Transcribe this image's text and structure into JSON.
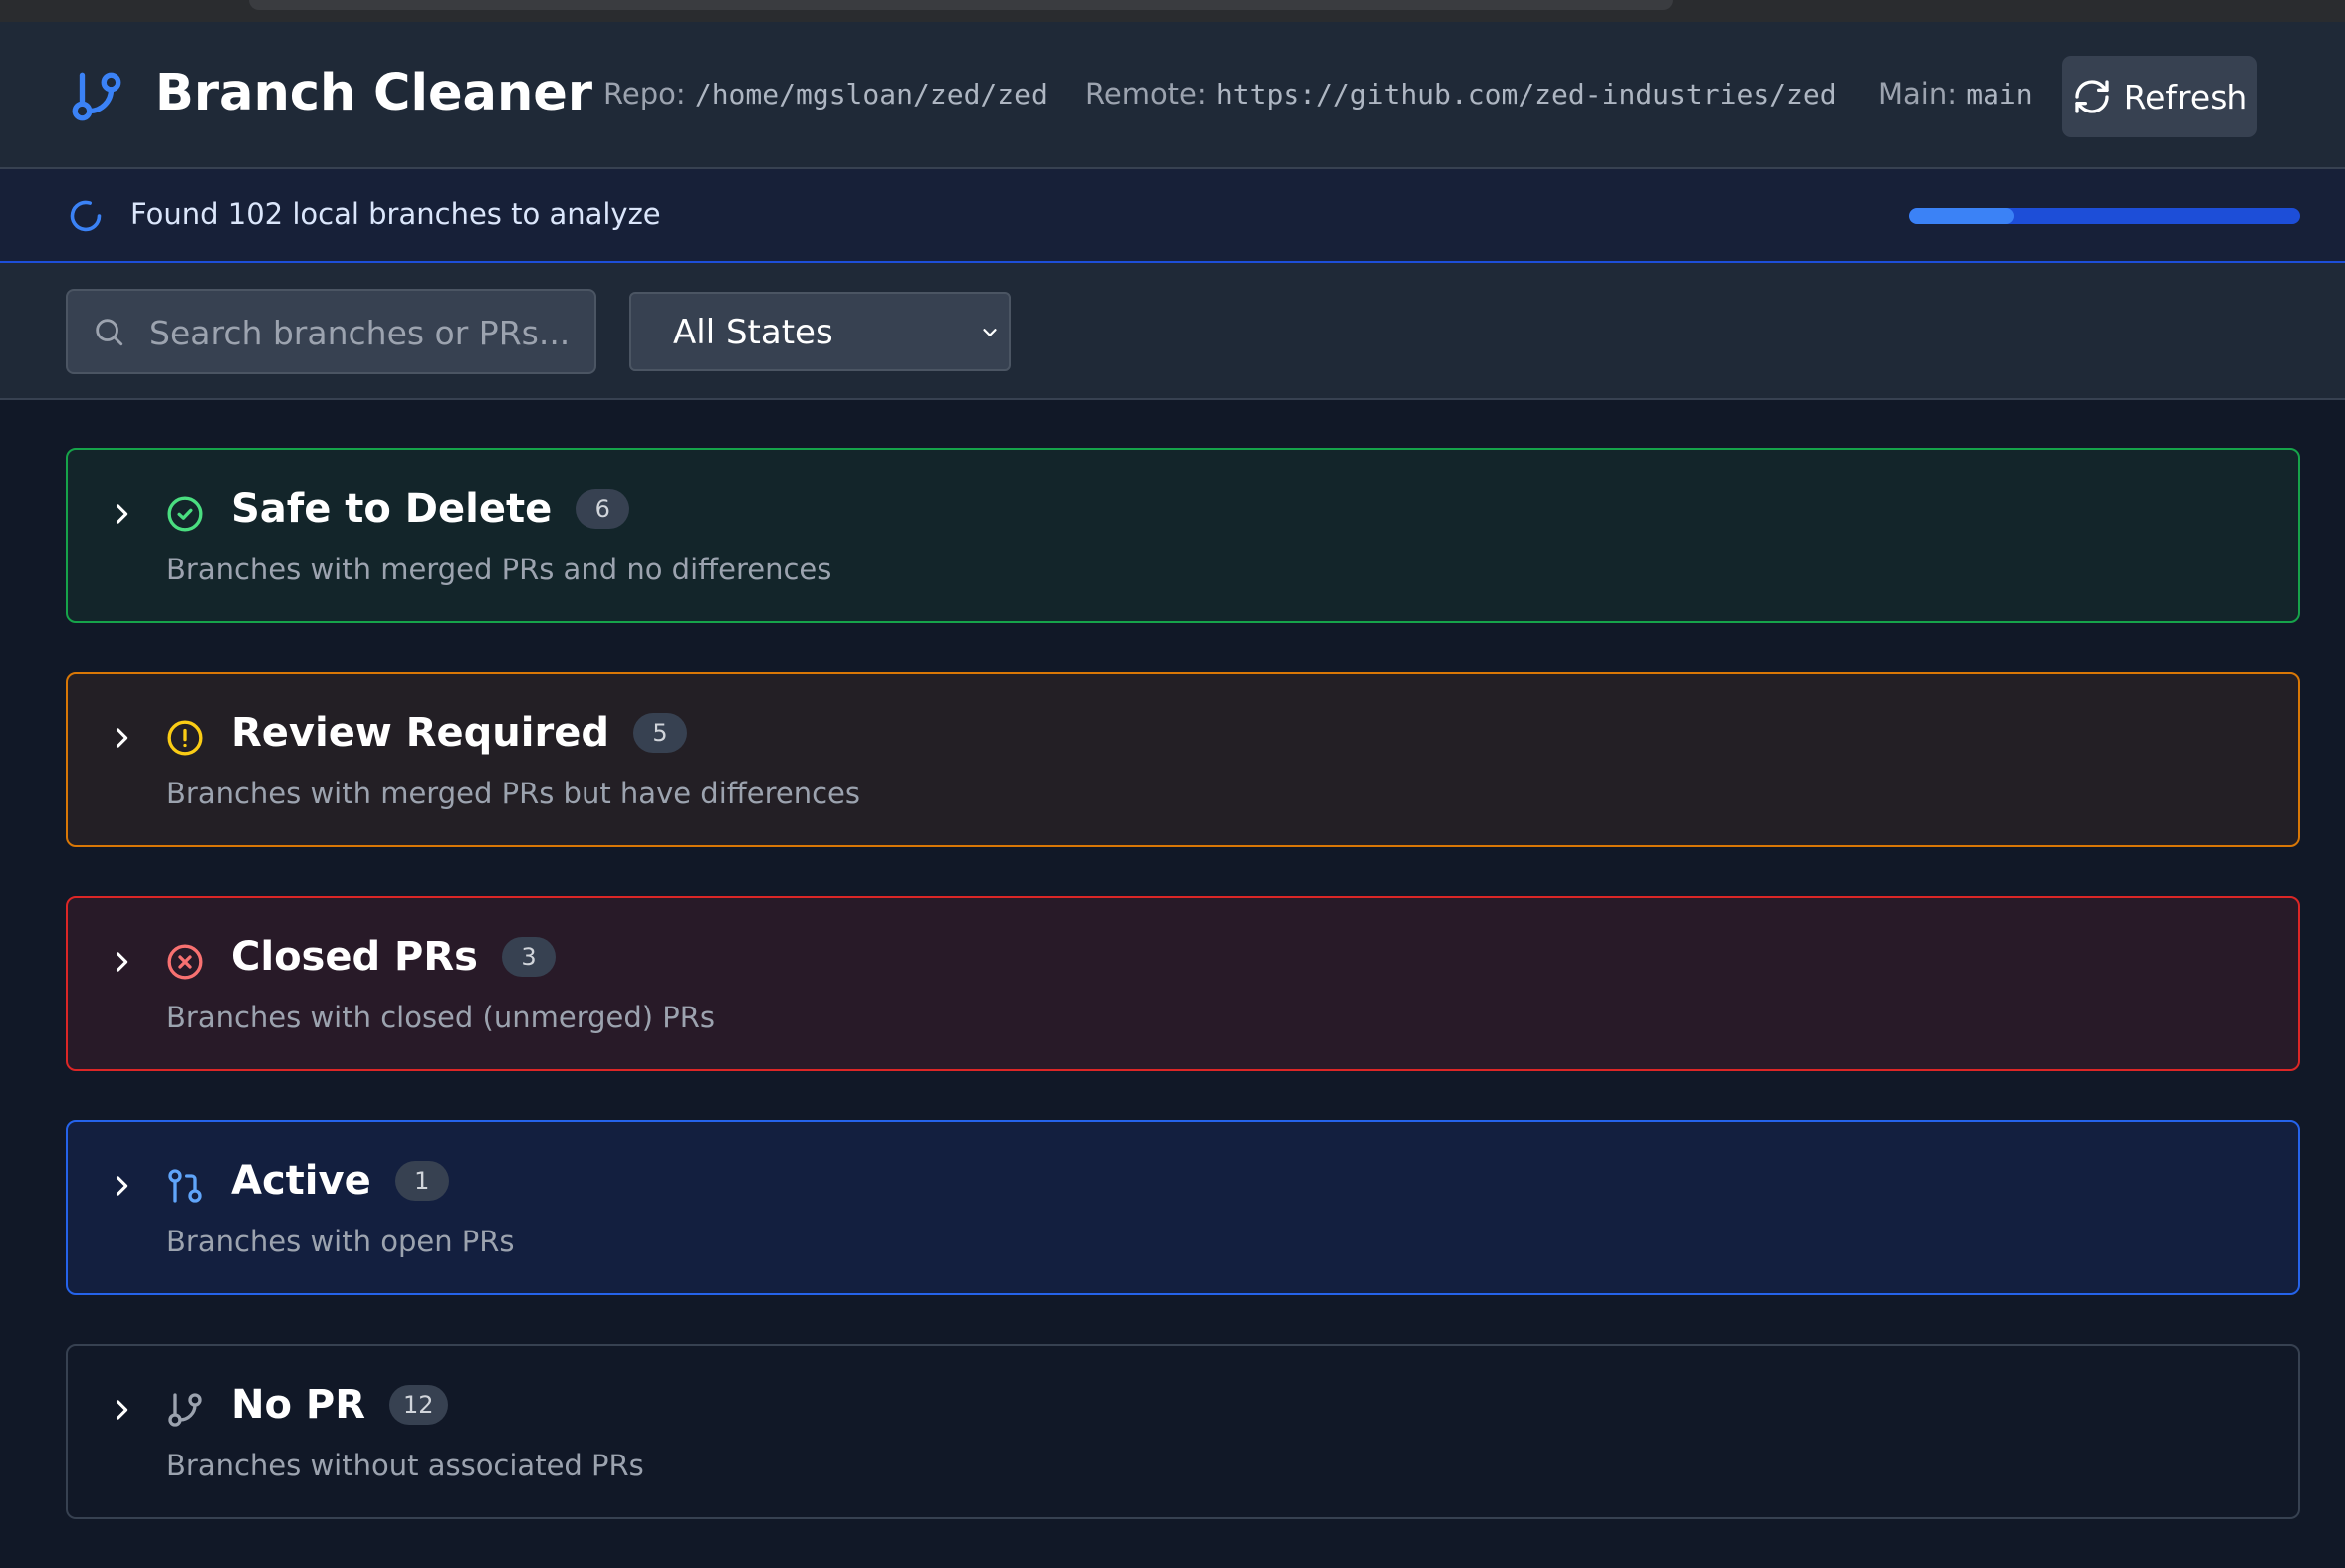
{
  "header": {
    "title": "Branch Cleaner",
    "repo_label": "Repo:",
    "repo_value": "/home/mgsloan/zed/zed",
    "remote_label": "Remote:",
    "remote_value": "https://github.com/zed-industries/zed",
    "main_label": "Main:",
    "main_value": "main",
    "refresh_label": "Refresh",
    "refresh_icon": "refresh-icon",
    "logo_icon": "git-branch-icon"
  },
  "status": {
    "text": "Found 102 local branches to analyze",
    "progress_fraction": 0.27,
    "icon": "spinner-icon"
  },
  "filters": {
    "search_placeholder": "Search branches or PRs...",
    "search_value": "",
    "state_selected": "All States"
  },
  "groups": [
    {
      "title": "Safe to Delete",
      "count": "6",
      "description": "Branches with merged PRs and no differences",
      "icon": "check-circle-icon",
      "border": "#16a34a",
      "bg": "#13252a",
      "icon_color": "#4ade80"
    },
    {
      "title": "Review Required",
      "count": "5",
      "description": "Branches with merged PRs but have differences",
      "icon": "alert-circle-icon",
      "border": "#d97706",
      "bg": "#231f25",
      "icon_color": "#facc15"
    },
    {
      "title": "Closed PRs",
      "count": "3",
      "description": "Branches with closed (unmerged) PRs",
      "icon": "x-circle-icon",
      "border": "#dc2626",
      "bg": "#281a28",
      "icon_color": "#f87171"
    },
    {
      "title": "Active",
      "count": "1",
      "description": "Branches with open PRs",
      "icon": "git-pull-request-icon",
      "border": "#2563eb",
      "bg": "#131f3f",
      "icon_color": "#60a5fa"
    },
    {
      "title": "No PR",
      "count": "12",
      "description": "Branches without associated PRs",
      "icon": "git-branch-icon",
      "border": "#374151",
      "bg": "#111827",
      "icon_color": "#9ca3af"
    }
  ]
}
